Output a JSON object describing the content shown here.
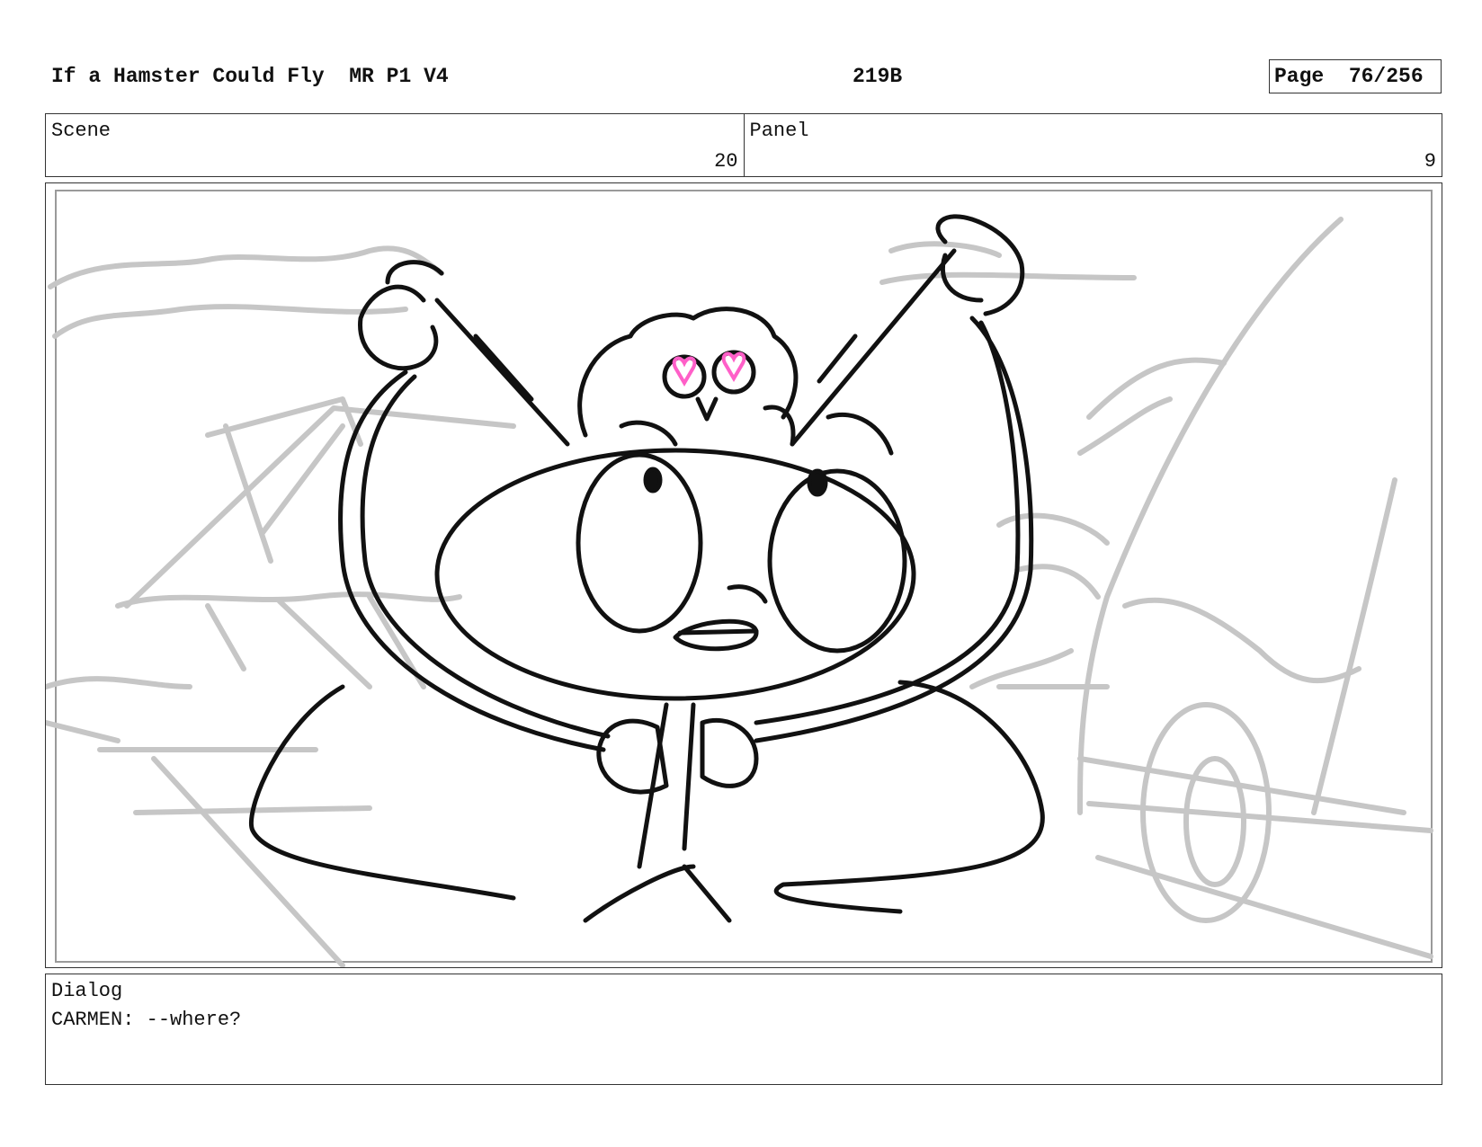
{
  "header": {
    "title": "If a Hamster Could Fly  MR P1 V4",
    "episode": "219B",
    "page": "Page  76/256"
  },
  "scene": {
    "label": "Scene",
    "value": "20"
  },
  "panel": {
    "label": "Panel",
    "value": "9"
  },
  "dialog": {
    "label": "Dialog",
    "line": "CARMEN: --where?"
  },
  "colors": {
    "ink": "#111111",
    "background_sketch": "#c4c4c4",
    "eye_hearts": "#ff5fc8"
  }
}
